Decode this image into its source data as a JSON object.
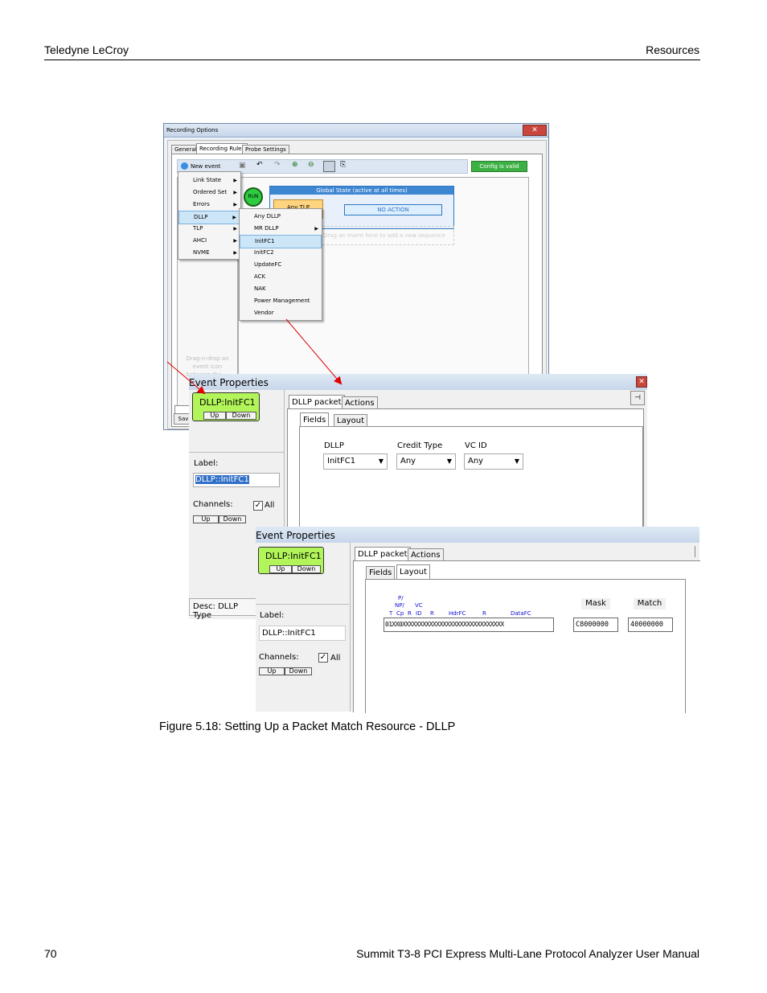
{
  "page": {
    "header_left": "Teledyne LeCroy",
    "header_right": "Resources",
    "caption": "Figure 5.18:  Setting Up a Packet Match Resource - DLLP",
    "footer_left": "70",
    "footer_right": "Summit T3-8 PCI Express Multi-Lane Protocol Analyzer User Manual"
  },
  "recording_options": {
    "title": "Recording Options",
    "close": "✕",
    "tabs": [
      "General",
      "Recording Rules",
      "Probe Settings"
    ],
    "new_event": "New event",
    "config_status": "Config is valid",
    "run": "RUN",
    "global_state": "Global State (active at all times)",
    "any_tlp": "Any TLP",
    "no_action": "NO ACTION",
    "add_sequence_hint": "Drag an event here to add a new sequence",
    "drag_hint": "Drag-n-drop an event icon between the ...",
    "save_button": "Sav",
    "menu1": [
      "Link State",
      "Ordered Set",
      "Errors",
      "DLLP",
      "TLP",
      "AHCI",
      "NVME"
    ],
    "menu2": [
      "Any DLLP",
      "MR DLLP",
      "InitFC1",
      "InitFC2",
      "UpdateFC",
      "ACK",
      "NAK",
      "Power Management",
      "Vendor"
    ]
  },
  "event_props_1": {
    "title": "Event Properties",
    "event_name": "DLLP:InitFC1",
    "up": "Up",
    "down": "Down",
    "label_caption": "Label:",
    "label_value": "DLLP::InitFC1",
    "channels": "Channels:",
    "all": "All",
    "desc": "Desc: DLLP Type",
    "tabs": [
      "DLLP packet",
      "Actions"
    ],
    "subtabs": [
      "Fields",
      "Layout"
    ],
    "fields": [
      {
        "name": "DLLP",
        "value": "InitFC1"
      },
      {
        "name": "Credit Type",
        "value": "Any"
      },
      {
        "name": "VC ID",
        "value": "Any"
      }
    ]
  },
  "event_props_2": {
    "title": "Event Properties",
    "event_name": "DLLP:InitFC1",
    "up": "Up",
    "down": "Down",
    "label_caption": "Label:",
    "label_value": "DLLP::InitFC1",
    "channels": "Channels:",
    "all": "All",
    "tabs": [
      "DLLP packet",
      "Actions"
    ],
    "subtabs": [
      "Fields",
      "Layout"
    ],
    "layout_labels_top": [
      "P/",
      "NP/",
      "VC"
    ],
    "layout_labels": [
      "T",
      "Cp",
      "R",
      "ID",
      "R",
      "HdrFC",
      "R",
      "DataFC"
    ],
    "bit_pattern": "01XX0XXXXXXXXXXXXXXXXXXXXXXXXXXXXXX",
    "mask_caption": "Mask",
    "mask_value": "C8000000",
    "match_caption": "Match",
    "match_value": "40000000"
  },
  "colors": {
    "event_green": "#b2f55a",
    "run_green": "#2ecc40",
    "config_green": "#3cb043",
    "arrow_red": "#e00000"
  }
}
